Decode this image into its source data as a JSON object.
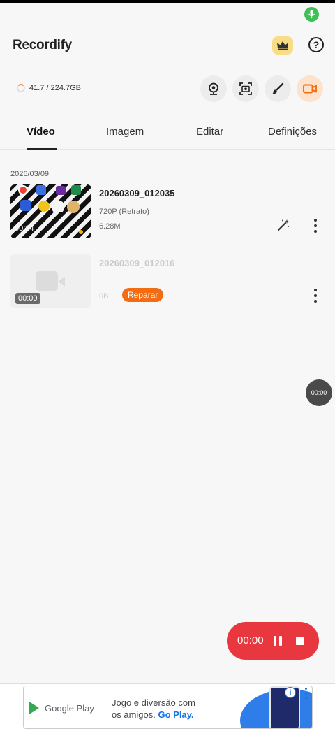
{
  "app": {
    "title": "Recordify"
  },
  "storage": {
    "text": "41.7 / 224.7GB",
    "used_fraction": 0.186
  },
  "tabs": [
    {
      "label": "Vídeo",
      "active": true
    },
    {
      "label": "Imagem",
      "active": false
    },
    {
      "label": "Editar",
      "active": false
    },
    {
      "label": "Definições",
      "active": false
    }
  ],
  "toolbar": {
    "icons": [
      "webcam-icon",
      "screenshot-icon",
      "brush-icon",
      "video-camera-icon"
    ]
  },
  "list": {
    "date": "2026/03/09",
    "items": [
      {
        "name": "20260309_012035",
        "duration": "00:24",
        "resolution": "720P (Retrato)",
        "size": "6.28M"
      },
      {
        "name": "20260309_012016",
        "duration": "00:00",
        "size": "0B",
        "badge": "Reparar"
      }
    ]
  },
  "floating_timer": "00:00",
  "recording": {
    "time": "00:00"
  },
  "ad": {
    "store": "Google Play",
    "line1": "Jogo e diversão com",
    "line2_plain": "os amigos. ",
    "line2_link": "Go Play.",
    "info": "i"
  },
  "colors": {
    "accent": "#e8373f",
    "badge": "#f36c12",
    "crown": "#f8dd86",
    "mic": "#3fbf55"
  }
}
